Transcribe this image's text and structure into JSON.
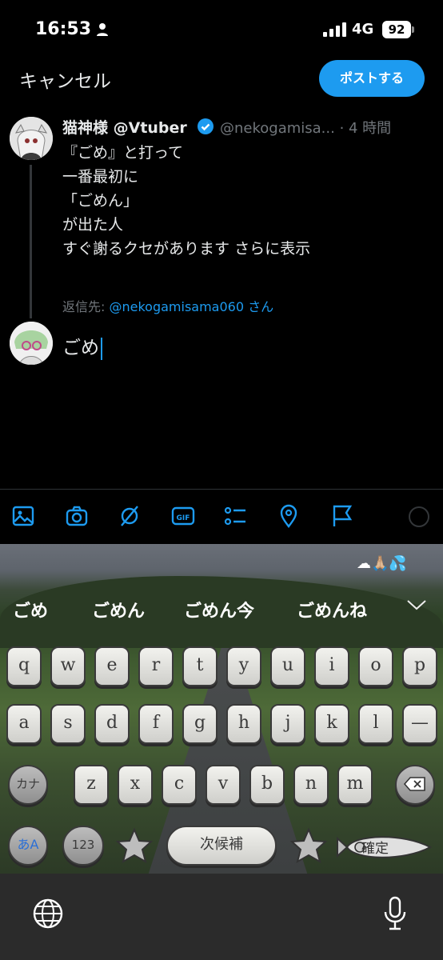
{
  "status_bar": {
    "time": "16:53",
    "network": "4G",
    "battery": "92"
  },
  "header": {
    "cancel_label": "キャンセル",
    "post_label": "ポストする"
  },
  "tweet": {
    "display_name": "猫神様 @Vtuber",
    "handle_time": "@nekogamisa... · 4 時間",
    "lines": [
      "『ごめ』と打って",
      "一番最初に",
      "「ごめん」",
      "が出た人",
      "すぐ謝るクセがあります"
    ],
    "show_more": "さらに表示"
  },
  "reply": {
    "prefix": "返信先: ",
    "target": "@nekogamisama060",
    "suffix": " さん"
  },
  "compose": {
    "text": "ごめ"
  },
  "toolbar": {
    "icons": [
      "image-icon",
      "camera-icon",
      "gif-picker-icon",
      "gif-icon",
      "poll-icon",
      "location-icon",
      "flag-icon",
      "progress-ring"
    ]
  },
  "keyboard": {
    "weather": "☁🙏🏼💦",
    "candidates": [
      "ごめ",
      "ごめん",
      "ごめん今",
      "ごめんね"
    ],
    "row1": [
      "q",
      "w",
      "e",
      "r",
      "t",
      "y",
      "u",
      "i",
      "o",
      "p"
    ],
    "row2": [
      "a",
      "s",
      "d",
      "f",
      "g",
      "h",
      "j",
      "k",
      "l",
      "—"
    ],
    "row3": [
      "z",
      "x",
      "c",
      "v",
      "b",
      "n",
      "m"
    ],
    "kana_label": "カナ",
    "mode_label": "あA",
    "num_label": "123",
    "space_label": "次候補",
    "enter_label": "確定"
  }
}
